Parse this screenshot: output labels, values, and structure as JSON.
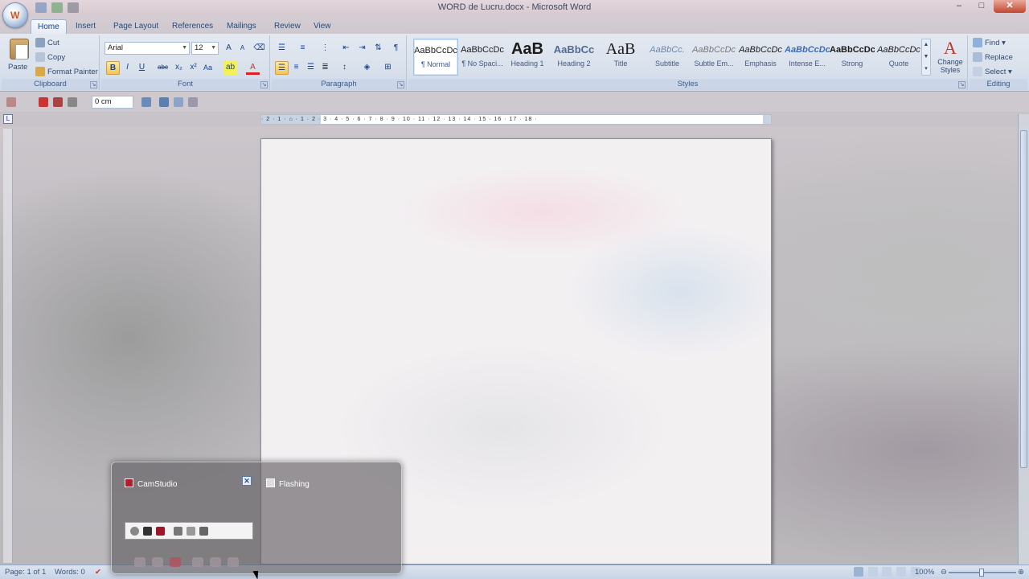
{
  "window": {
    "title": "WORD de Lucru.docx - Microsoft Word",
    "office_button_glyph": "W",
    "controls": {
      "minimize": "–",
      "maximize": "□",
      "close": "✕"
    }
  },
  "tabs": [
    {
      "label": "Home",
      "active": true
    },
    {
      "label": "Insert",
      "active": false
    },
    {
      "label": "Page Layout",
      "active": false
    },
    {
      "label": "References",
      "active": false
    },
    {
      "label": "Mailings",
      "active": false
    },
    {
      "label": "Review",
      "active": false
    },
    {
      "label": "View",
      "active": false
    }
  ],
  "ribbon": {
    "clipboard": {
      "label": "Clipboard",
      "paste": "Paste",
      "cut": "Cut",
      "copy": "Copy",
      "format_painter": "Format Painter"
    },
    "font": {
      "label": "Font",
      "font_name": "Arial",
      "font_size": "12",
      "grow": "A",
      "shrink": "A",
      "bold": "B",
      "italic": "I",
      "underline": "U",
      "strikethrough": "abc",
      "subscript": "x₂",
      "superscript": "x²",
      "change_case": "Aa",
      "font_color": "A"
    },
    "paragraph": {
      "label": "Paragraph",
      "show_marks": "¶"
    },
    "styles": {
      "label": "Styles",
      "items": [
        {
          "sample": "AaBbCcDc",
          "name": "¶ Normal",
          "selected": true
        },
        {
          "sample": "AaBbCcDc",
          "name": "¶ No Spaci...",
          "selected": false
        },
        {
          "sample": "AaB",
          "name": "Heading 1",
          "selected": false
        },
        {
          "sample": "AaBbCc",
          "name": "Heading 2",
          "selected": false
        },
        {
          "sample": "AaB",
          "name": "Title",
          "selected": false
        },
        {
          "sample": "AaBbCc.",
          "name": "Subtitle",
          "selected": false
        },
        {
          "sample": "AaBbCcDc",
          "name": "Subtle Em...",
          "selected": false
        },
        {
          "sample": "AaBbCcDc",
          "name": "Emphasis",
          "selected": false
        },
        {
          "sample": "AaBbCcDc",
          "name": "Intense E...",
          "selected": false
        },
        {
          "sample": "AaBbCcDc",
          "name": "Strong",
          "selected": false
        },
        {
          "sample": "AaBbCcDc",
          "name": "Quote",
          "selected": false
        }
      ],
      "change_styles": "Change Styles"
    },
    "editing": {
      "label": "Editing",
      "find": "Find",
      "replace": "Replace",
      "select": "Select"
    }
  },
  "toolbar2": {
    "indent_value": "0 cm"
  },
  "ruler": {
    "numbers": "· 2 · 1 · ⌂ · 1 · 2 · 3 · 4 · 5 · 6 · 7 · 8 · 9 · 10 · 11 · 12 · 13 · 14 · 15 · 16 · 17 · 18 ·"
  },
  "status": {
    "page": "Page: 1 of 1",
    "words": "Words: 0",
    "zoom": "100%"
  },
  "taskbar_preview": {
    "items": [
      {
        "title": "CamStudio",
        "has_close": true
      },
      {
        "title": "Flashing",
        "has_close": false
      }
    ]
  },
  "colors": {
    "accent": "#15428b",
    "ribbon": "#dfe6ef",
    "selected_style": "#ffffff",
    "highlight": "#f6c552"
  }
}
